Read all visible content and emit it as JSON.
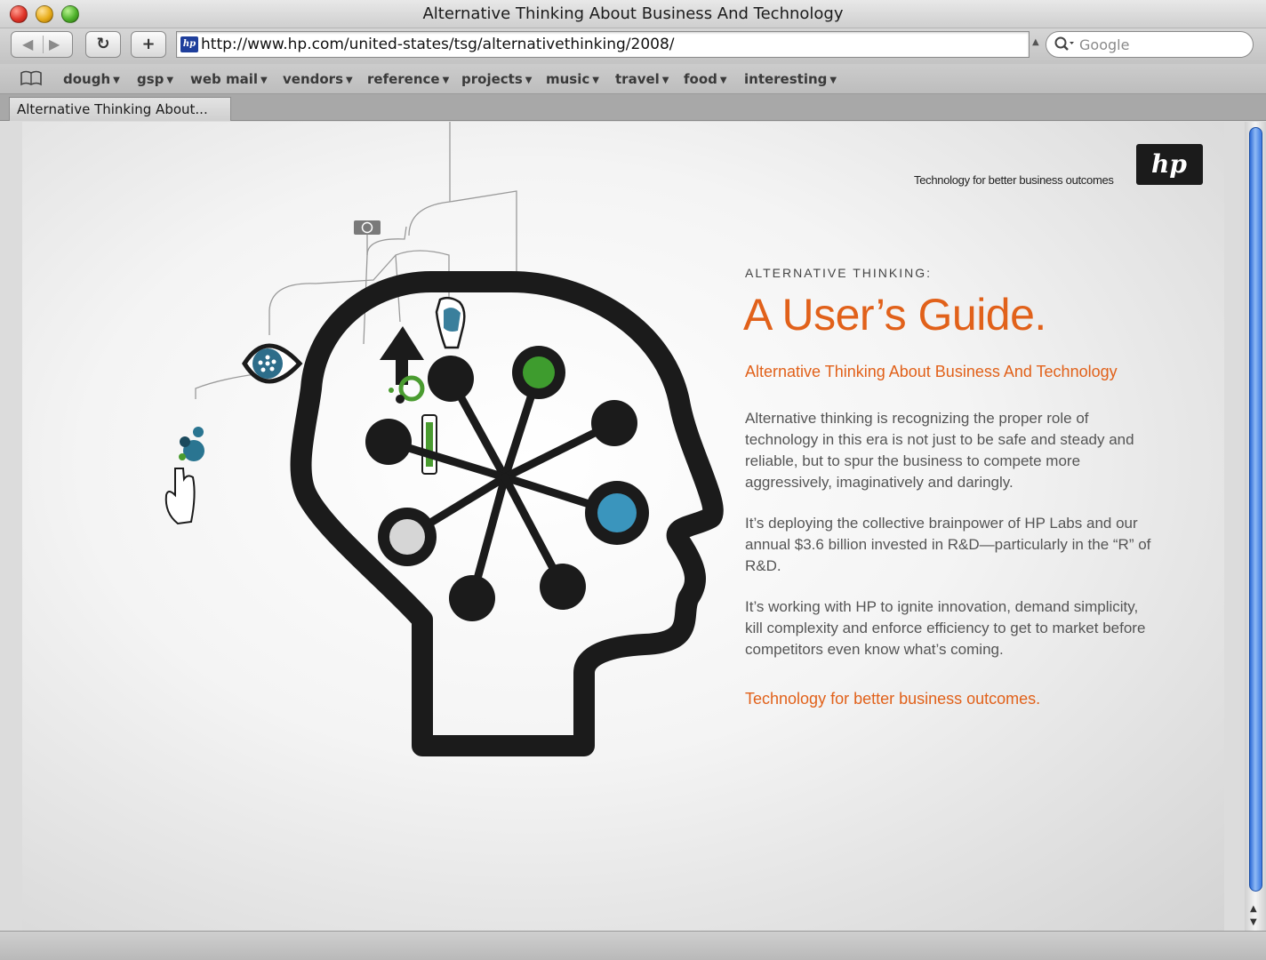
{
  "window": {
    "title": "Alternative Thinking About Business And Technology"
  },
  "toolbar": {
    "back_glyph": "◀",
    "forward_glyph": "▶",
    "reload_glyph": "↻",
    "add_glyph": "+",
    "favicon_text": "hp",
    "url": "http://www.hp.com/united-states/tsg/alternativethinking/2008/",
    "search_placeholder": "Google"
  },
  "bookmarks": {
    "items": [
      {
        "label": "dough"
      },
      {
        "label": "gsp"
      },
      {
        "label": "web mail"
      },
      {
        "label": "vendors"
      },
      {
        "label": "reference"
      },
      {
        "label": "projects"
      },
      {
        "label": "music"
      },
      {
        "label": "travel"
      },
      {
        "label": "food"
      },
      {
        "label": "interesting"
      }
    ],
    "caret": "▼"
  },
  "tabs": [
    {
      "label": "Alternative Thinking About..."
    }
  ],
  "page": {
    "tagline": "Technology for better business outcomes",
    "logo_text": "hp",
    "eyebrow": "ALTERNATIVE THINKING:",
    "headline": "A User’s Guide.",
    "subhead": "Alternative Thinking About Business And Technology",
    "paragraphs": [
      "Alternative thinking is recognizing the proper role of technology in this era is not just to be safe and steady and reliable, but to spur the business to compete more aggressively, imaginatively and daringly.",
      "It’s deploying the collective brainpower of HP Labs and our annual $3.6 billion invested in R&D—particularly in the “R” of R&D.",
      "It’s working with HP to ignite innovation, demand simplicity, kill complexity and enforce efficiency to get to market before competitors even know what’s coming."
    ],
    "closing": "Technology for better business outcomes."
  },
  "colors": {
    "accent_orange": "#e1611a",
    "node_green": "#3e9c2e",
    "node_blue": "#3a95bd",
    "node_gray": "#d6d6d6",
    "ink": "#1b1b1b"
  }
}
